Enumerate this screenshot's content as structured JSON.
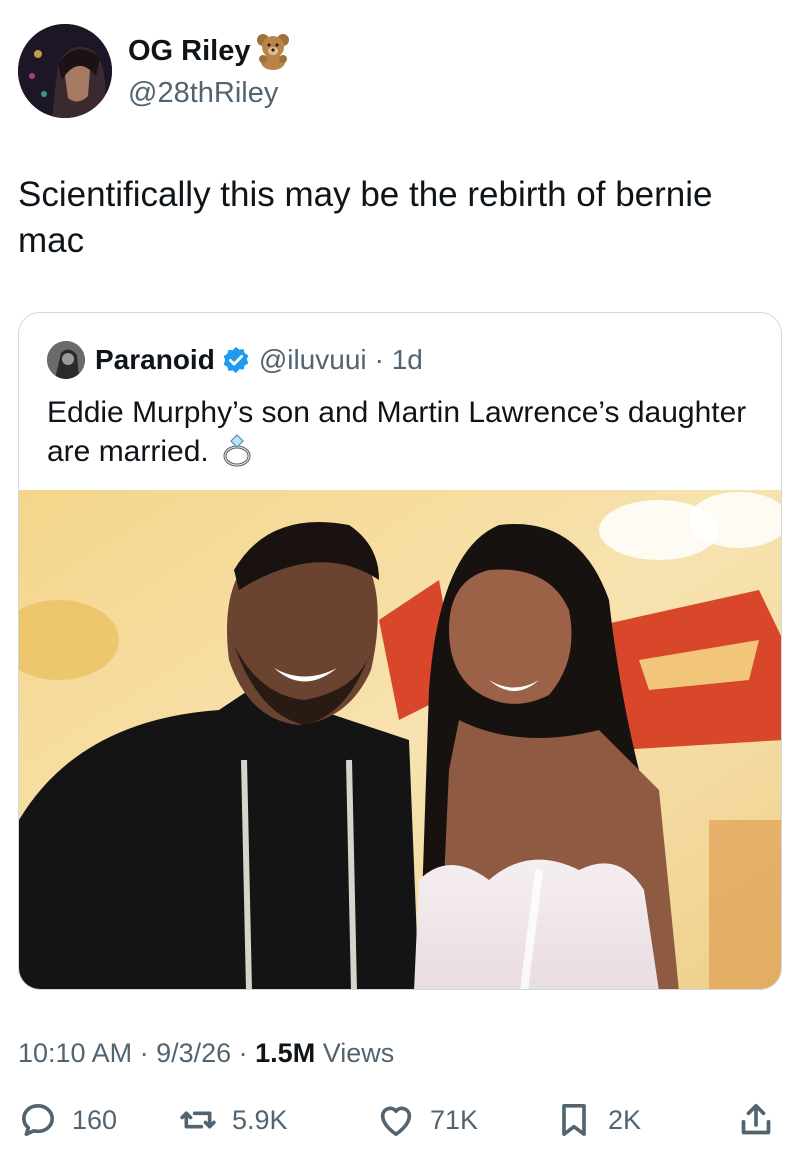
{
  "author": {
    "display_name": "OG Riley",
    "handle": "@28thRiley",
    "name_emoji": "teddy-bear-icon"
  },
  "tweet": {
    "text": "Scientifically this may be the rebirth of bernie mac"
  },
  "quoted": {
    "display_name": "Paranoid",
    "handle": "@iluvuui",
    "age": "· 1d",
    "text": "Eddie Murphy’s son and Martin Lawrence’s daughter are married.",
    "emoji": "ring-icon",
    "verified_color": "#1d9bf0"
  },
  "meta": {
    "time": "10:10 AM",
    "sep1": " · ",
    "date": "9/3/26",
    "sep2": " · ",
    "views_count": "1.5M",
    "views_label": " Views"
  },
  "actions": {
    "replies": "160",
    "reposts": "5.9K",
    "likes": "71K",
    "bookmarks": "2K"
  },
  "colors": {
    "text": "#0f1419",
    "secondary": "#536471",
    "border": "#cfd9de"
  }
}
